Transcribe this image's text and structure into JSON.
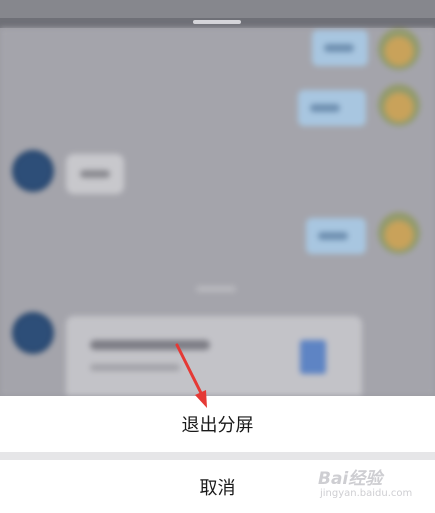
{
  "sheet": {
    "primary_action": "退出分屏",
    "cancel": "取消"
  },
  "watermark": {
    "brand": "Bai经验",
    "url": "jingyan.baidu.com"
  },
  "colors": {
    "annotation_arrow": "#e53935",
    "sheet_background": "#ffffff",
    "dimmed_background": "#9a9aa1"
  }
}
